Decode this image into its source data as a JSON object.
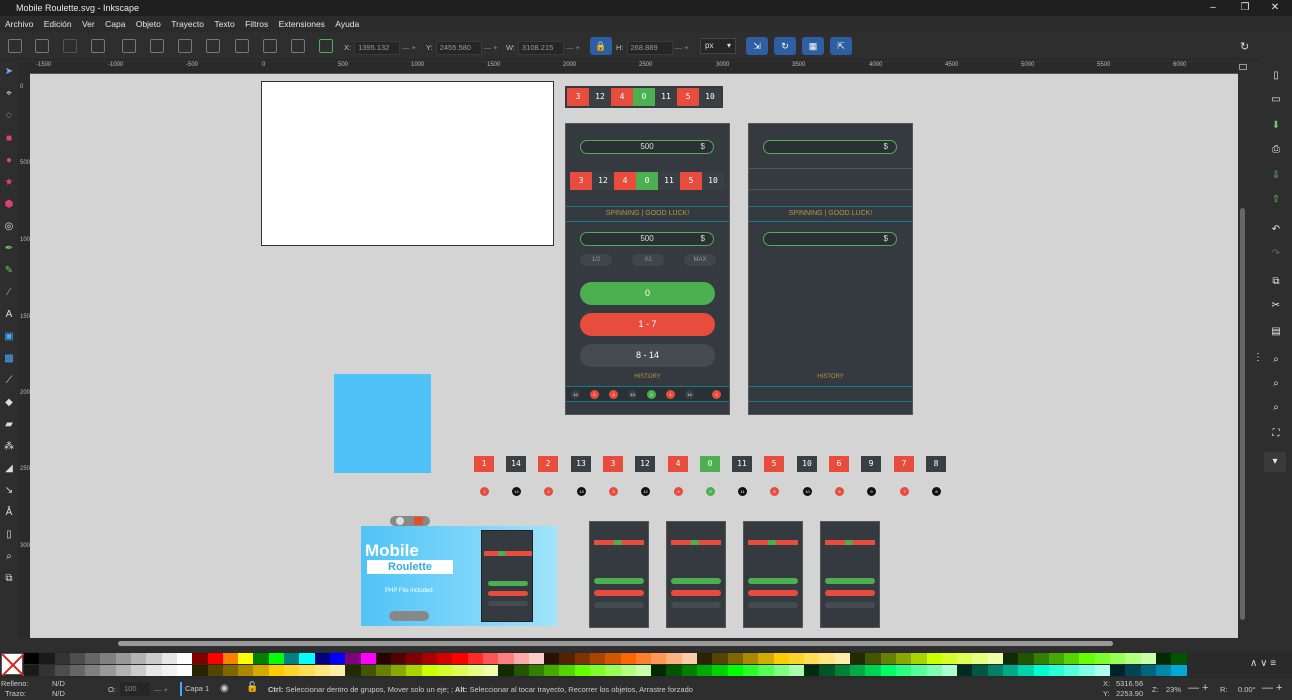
{
  "window": {
    "title": "Mobile Roulette.svg - Inkscape"
  },
  "menu": [
    "Archivo",
    "Edición",
    "Ver",
    "Capa",
    "Objeto",
    "Trayecto",
    "Texto",
    "Filtros",
    "Extensiones",
    "Ayuda"
  ],
  "toolbar": {
    "x_label": "X:",
    "x_value": "1395.132",
    "y_label": "Y:",
    "y_value": "2455.580",
    "w_label": "W:",
    "w_value": "3108.215",
    "h_label": "H:",
    "h_value": "268.889",
    "unit": "px"
  },
  "ruler": {
    "marks": [
      "-1500",
      "-1000",
      "-500",
      "0",
      "500",
      "1000",
      "1500",
      "2000",
      "2500",
      "3000",
      "3500",
      "4000",
      "4500",
      "5000",
      "5500",
      "6000"
    ]
  },
  "vruler": {
    "marks": [
      "0",
      "500",
      "1000",
      "1500",
      "2000",
      "2500",
      "3000"
    ]
  },
  "canvas": {
    "top_strip": [
      "3",
      "12",
      "4",
      "0",
      "11",
      "5",
      "10"
    ],
    "top_strip_colors": [
      "r",
      "k",
      "r",
      "g",
      "k",
      "r",
      "k"
    ],
    "phone1": {
      "bet_value": "500",
      "currency": "$",
      "strip": [
        "3",
        "12",
        "4",
        "0",
        "11",
        "5",
        "10"
      ],
      "spinning": "SPINNING | GOOD LUCK!",
      "bet2": "500",
      "half": "1/2",
      "double": "X2",
      "max": "MAX",
      "btn_green": "0",
      "btn_red": "1 - 7",
      "btn_black": "8 - 14",
      "history_label": "HISTORY",
      "history": [
        "12",
        "2",
        "3",
        "13",
        "0",
        "1",
        "14",
        "2"
      ]
    },
    "phone2": {
      "currency": "$",
      "spinning": "SPINNING | GOOD LUCK!",
      "history_label": "HISTORY"
    },
    "tiles": [
      "1",
      "14",
      "2",
      "13",
      "3",
      "12",
      "4",
      "0",
      "11",
      "5",
      "10",
      "6",
      "9",
      "7",
      "8"
    ],
    "tile_colors": [
      "r",
      "k",
      "r",
      "k",
      "r",
      "k",
      "r",
      "g",
      "k",
      "r",
      "k",
      "r",
      "k",
      "r",
      "k"
    ],
    "promo": {
      "title1": "Mobile",
      "title2": "Roulette",
      "sub": "PHP File included"
    }
  },
  "status": {
    "fill_label": "Relleno:",
    "fill_value": "N/D",
    "stroke_label": "Trazo:",
    "stroke_value": "N/D",
    "opacity_label": "O:",
    "opacity_value": "100",
    "layer": "Capa 1",
    "message_ctrl": "Ctrl:",
    "message_ctrl_text": " Seleccionar dentro de grupos, Mover solo un eje; ;",
    "message_alt": " Alt:",
    "message_alt_text": " Seleccionar al tocar trayecto, Recorrer los objetos, Arrastre forzado",
    "cursor_x_label": "X:",
    "cursor_x": "5316.56",
    "cursor_y_label": "Y:",
    "cursor_y": "2253.90",
    "zoom_label": "Z:",
    "zoom": "23%",
    "rotation_label": "R:",
    "rotation": "0.00°"
  },
  "colors": {
    "red": "#e74c3c",
    "green": "#4caf50",
    "dark": "#3a3f44",
    "blue": "#4fc3f7",
    "accent_gold": "#b8963c"
  }
}
